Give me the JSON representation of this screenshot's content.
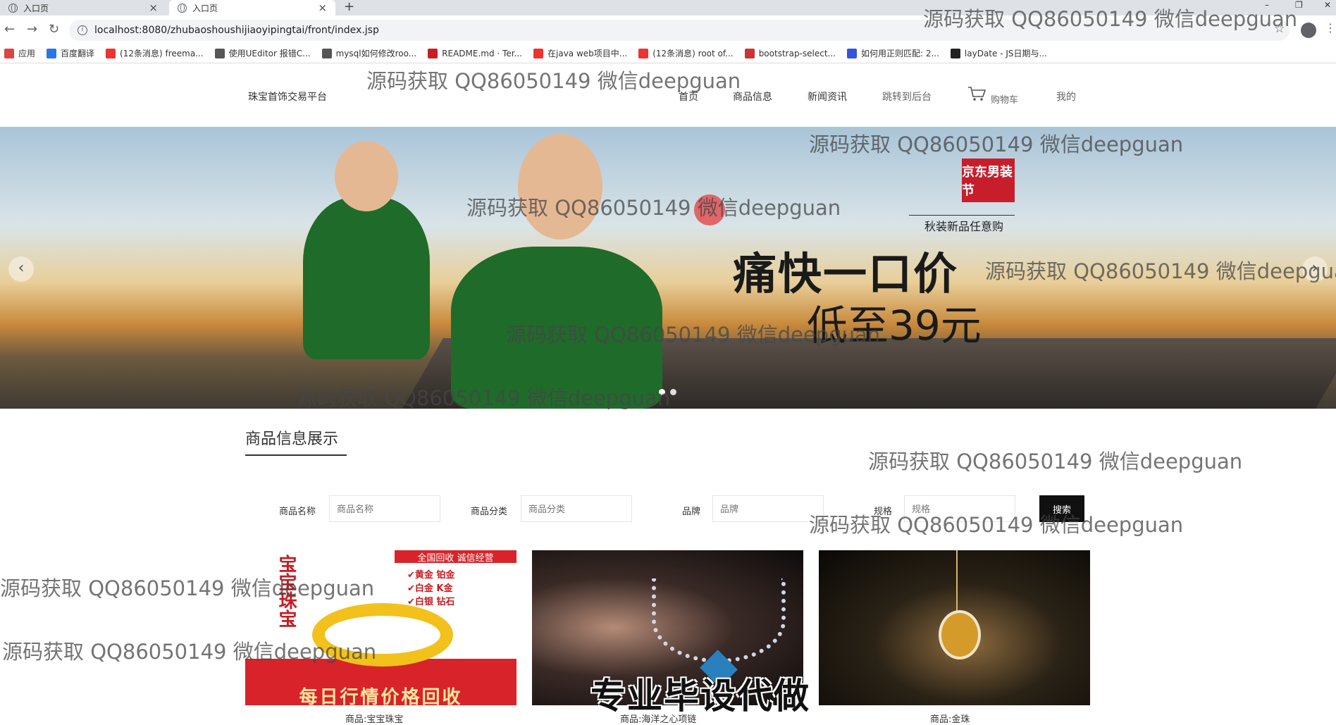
{
  "browser": {
    "tabs": [
      {
        "title": "入口页",
        "active": false
      },
      {
        "title": "入口页",
        "active": true
      }
    ],
    "url": "localhost:8080/zhubaoshoushijiaoyipingtai/front/index.jsp",
    "bookmarks": [
      {
        "label": "应用",
        "icon": "apps-icon",
        "color": "#d44"
      },
      {
        "label": "百度翻译",
        "icon": "translate-icon",
        "color": "#2b76e5"
      },
      {
        "label": "(12条消息) freema...",
        "icon": "csdn-icon",
        "color": "#e33"
      },
      {
        "label": "使用UEditor 报错C...",
        "icon": "link-icon",
        "color": "#555"
      },
      {
        "label": "mysql如何修改roo...",
        "icon": "link-icon",
        "color": "#555"
      },
      {
        "label": "README.md · Ter...",
        "icon": "gitee-icon",
        "color": "#c71d23"
      },
      {
        "label": "在java web项目中...",
        "icon": "csdn-icon",
        "color": "#e33"
      },
      {
        "label": "(12条消息) root of...",
        "icon": "csdn-icon",
        "color": "#e33"
      },
      {
        "label": "bootstrap-select...",
        "icon": "blog-icon",
        "color": "#c33"
      },
      {
        "label": "如何用正则匹配: 2...",
        "icon": "baidu-icon",
        "color": "#3355dd"
      },
      {
        "label": "layDate - JS日期与...",
        "icon": "layui-icon",
        "color": "#222"
      }
    ]
  },
  "site": {
    "logo": "珠宝首饰交易平台",
    "nav": [
      {
        "label": "首页"
      },
      {
        "label": "商品信息"
      },
      {
        "label": "新闻资讯"
      },
      {
        "label": "跳转到后台"
      },
      {
        "label": "购物车"
      },
      {
        "label": "我的"
      }
    ]
  },
  "banner": {
    "brand_badge": "京东男装节",
    "subtitle": "秋装新品任意购",
    "headline": "痛快一口价",
    "price_text": "低至39元",
    "prev_arrow": "‹",
    "next_arrow": "›",
    "dots": 2,
    "active_dot": 0
  },
  "products_section": {
    "title": "商品信息展示",
    "filters": [
      {
        "label": "商品名称",
        "placeholder": "商品名称"
      },
      {
        "label": "商品分类",
        "placeholder": "商品分类"
      },
      {
        "label": "品牌",
        "placeholder": "品牌"
      },
      {
        "label": "规格",
        "placeholder": "规格"
      }
    ],
    "search_label": "搜索",
    "items": [
      {
        "name": "商品:宝宝珠宝",
        "image_texts": {
          "top_banner": "全国回收 诚信经营",
          "list": [
            "✔黄金 铂金",
            "✔白金 K金",
            "✔白银 钻石"
          ],
          "side": "宝宝珠宝",
          "bottom": "每日行情价格回收"
        }
      },
      {
        "name": "商品:海洋之心项链"
      },
      {
        "name": "商品:金珠"
      }
    ]
  },
  "overlays": {
    "watermark": "源码获取 QQ86050149 微信deepguan",
    "bottom_banner": "专业毕设代做"
  }
}
